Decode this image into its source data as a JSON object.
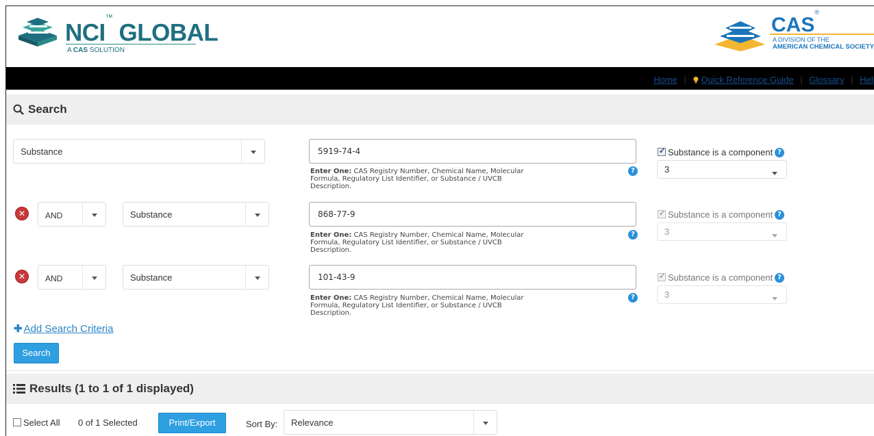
{
  "header": {
    "nci_brand": "NCI",
    "nci_brand_tm": "™",
    "nci_brand_rest": " GLOBAL",
    "nci_tagline_prefix": "A ",
    "nci_tagline_bold": "CAS",
    "nci_tagline_suffix": " SOLUTION",
    "cas_brand": "CAS",
    "cas_reg": "®",
    "cas_division": "A DIVISION OF THE",
    "cas_society": "AMERICAN CHEMICAL SOCIETY"
  },
  "nav": {
    "home": "Home",
    "quick_ref": "Quick Reference Guide",
    "glossary": "Glossary",
    "help": "Help",
    "separator": "|"
  },
  "search_section": {
    "title": "Search",
    "help_bold": "Enter One:",
    "help_text": "CAS Registry Number, Chemical Name, Molecular Formula, Regulatory List Identifier, or Substance / UVCB Description.",
    "component_label": "Substance is a component",
    "rows": [
      {
        "operator": "",
        "field": "Substance",
        "value": "5919-74-4",
        "component_checked": true,
        "component_value": "3",
        "disabled": false
      },
      {
        "operator": "AND",
        "field": "Substance",
        "value": "868-77-9",
        "component_checked": true,
        "component_value": "3",
        "disabled": true
      },
      {
        "operator": "AND",
        "field": "Substance",
        "value": "101-43-9",
        "component_checked": true,
        "component_value": "3",
        "disabled": true
      }
    ],
    "add_criteria_label": "Add Search Criteria",
    "search_button": "Search"
  },
  "results_section": {
    "title": "Results (1 to 1 of 1 displayed)",
    "select_all_label": "Select All",
    "selected_count": "0 of 1 Selected",
    "print_export_button": "Print/Export",
    "sort_by_label": "Sort By:",
    "sort_value": "Relevance"
  },
  "colors": {
    "nci_teal": "#1f6f80",
    "cas_blue": "#1b75bb",
    "cas_gold": "#f2b630",
    "button_blue": "#2e9fe0",
    "remove_red": "#c73a3a",
    "link_blue": "#1a4d8f"
  },
  "icons": {
    "search": "magnifier-icon",
    "results": "list-icon",
    "quick_ref": "lightbulb-icon",
    "help": "question-circle-icon",
    "remove": "close-circle-icon",
    "add": "plus-icon",
    "dropdown": "caret-down-icon"
  }
}
